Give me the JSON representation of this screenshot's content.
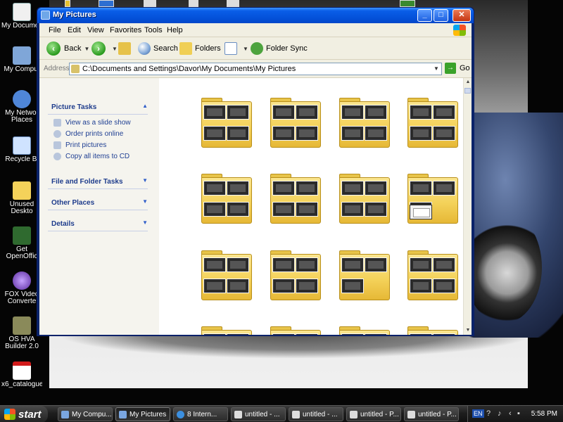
{
  "window": {
    "title": "My Pictures",
    "minimize": "_",
    "maximize": "□",
    "close": "✕"
  },
  "menu": [
    "File",
    "Edit",
    "View",
    "Favorites",
    "Tools",
    "Help"
  ],
  "toolbar": {
    "back": "Back",
    "search": "Search",
    "folders": "Folders",
    "folder_sync": "Folder Sync"
  },
  "address": {
    "label": "Address",
    "value": "C:\\Documents and Settings\\Davor\\My Documents\\My Pictures",
    "go": "Go"
  },
  "taskpane": {
    "picture_tasks": "Picture Tasks",
    "links": [
      "View as a slide show",
      "Order prints online",
      "Print pictures",
      "Copy all items to CD"
    ],
    "file_folder_tasks": "File and Folder Tasks",
    "other_places": "Other Places",
    "details": "Details"
  },
  "desktop_icons": [
    "My Document",
    "My Comput",
    "My Networ Places",
    "Recycle Bi",
    "Unused Deskto",
    "Get OpenOffic",
    "FOX Video Converte",
    "OS HVA Builder 2.0",
    "x6_catalogue"
  ],
  "taskbar": {
    "start": "start",
    "tasks": [
      "My Compu...",
      "My Pictures",
      "8 Intern...",
      "untitled - ...",
      "untitled - ...",
      "untitled - P...",
      "untitled - P..."
    ],
    "lang": "EN",
    "clock": "5:58 PM"
  },
  "colors": {
    "title_blue": "#0350d8",
    "folder_yellow": "#f4d25a",
    "link_blue": "#1f3f93"
  }
}
